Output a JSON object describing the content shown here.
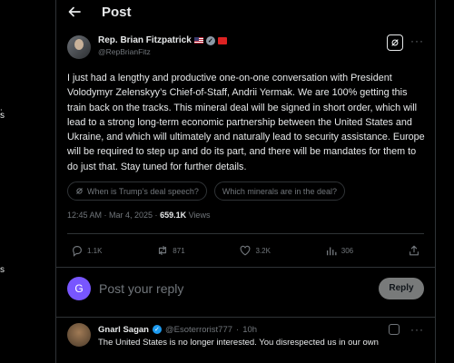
{
  "rail": {
    "marks": [
      ":",
      "s",
      "s"
    ]
  },
  "header": {
    "title": "Post"
  },
  "post": {
    "author_name": "Rep. Brian Fitzpatrick",
    "handle": "@RepBrianFitz",
    "text": "I just had a lengthy and productive one-on-one conversation with President Volodymyr Zelenskyy’s Chief-of-Staff, Andrii Yermak. We are 100% getting this train back on the tracks.  This mineral deal will be signed in short order, which will lead to a strong long-term economic partnership between the United States and Ukraine, and which will ultimately and naturally lead to security assistance. Europe will be required to step up and do its part, and there will be mandates for them to do just that.  Stay tuned for further details.",
    "chips": [
      "When is Trump’s deal speech?",
      "Which minerals are in the deal?"
    ],
    "time": "12:45 AM · Mar 4, 2025 · ",
    "views_count": "659.1K",
    "views_label": " Views"
  },
  "actions": {
    "replies": "1.1K",
    "reposts": "871",
    "likes": "3.2K",
    "bookmarks": "306"
  },
  "reply": {
    "avatar_letter": "G",
    "placeholder": "Post your reply",
    "button": "Reply"
  },
  "comment": {
    "name": "Gnarl Sagan",
    "handle": "@Esoterrorist777",
    "dot": "·",
    "time": "10h",
    "text": "The United States is no longer interested. You disrespected us in our own"
  },
  "colors": {
    "background": "#000000",
    "text": "#e7e9ea",
    "muted": "#71767b",
    "border": "#2f3336",
    "reply_avatar": "#7856ff",
    "verified_blue": "#1d9bf0"
  },
  "icons": [
    "back-arrow-icon",
    "verified-icon",
    "grok-icon",
    "more-icon",
    "reply-icon",
    "repost-icon",
    "like-icon",
    "views-chart-icon",
    "bookmark-icon",
    "share-icon"
  ]
}
